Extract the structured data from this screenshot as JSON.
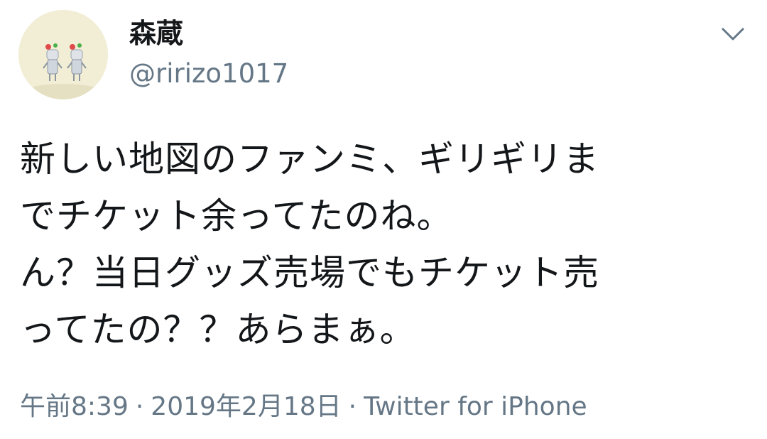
{
  "user": {
    "display_name": "森蔵",
    "handle": "@ririzo1017",
    "avatar_icon": "avatar-image-icon"
  },
  "menu": {
    "caret_icon": "chevron-down-icon"
  },
  "tweet": {
    "lines": [
      "新しい地図のファンミ、ギリギリま",
      "でチケット余ってたのね。",
      "ん？当日グッズ売場でもチケット売",
      "ってたの？？あらまぁ。"
    ]
  },
  "meta": {
    "time": "午前8:39",
    "separator": "·",
    "date": "2019年2月18日",
    "source": "Twitter for iPhone"
  },
  "colors": {
    "text": "#14171a",
    "secondary": "#657786",
    "background": "#ffffff"
  }
}
